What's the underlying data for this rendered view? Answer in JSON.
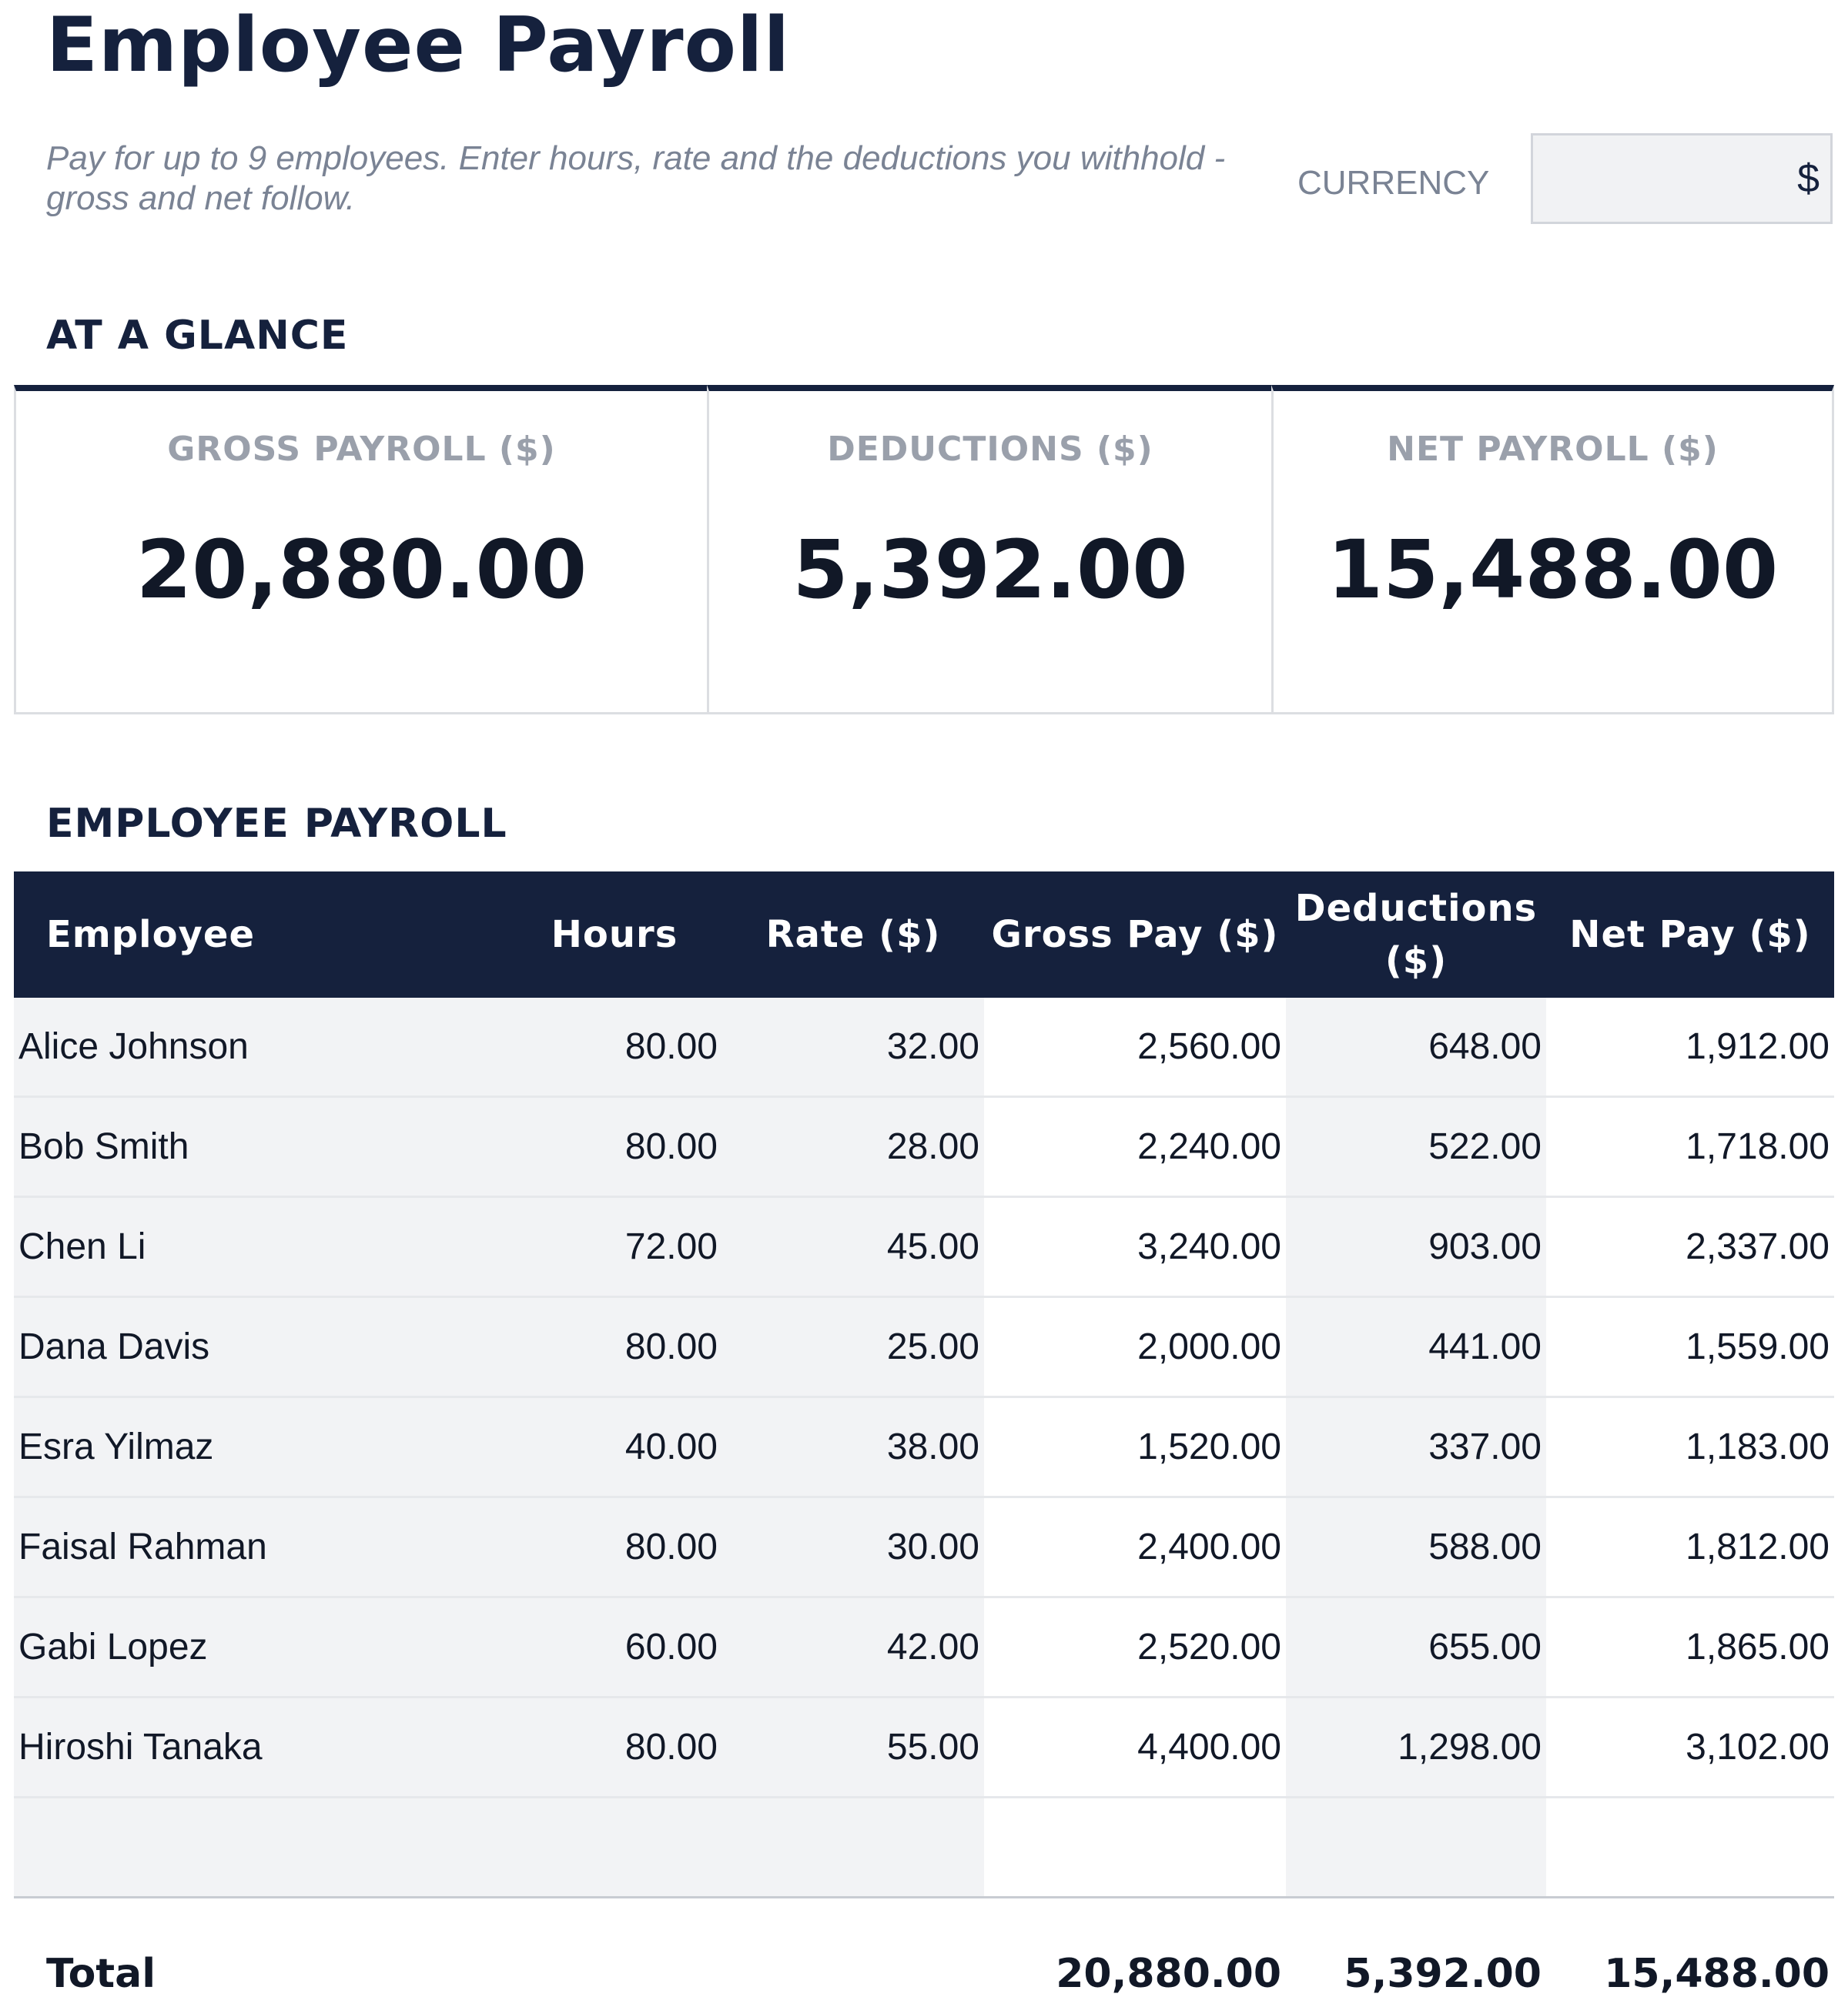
{
  "header": {
    "title": "Employee Payroll",
    "subtitle": "Pay for up to 9 employees. Enter hours, rate and the deductions you withhold - gross and net follow.",
    "currency_label": "CURRENCY",
    "currency_value": "$"
  },
  "glance": {
    "heading": "AT A GLANCE",
    "kpis": [
      {
        "label": "GROSS PAYROLL ($)",
        "value": "20,880.00"
      },
      {
        "label": "DEDUCTIONS ($)",
        "value": "5,392.00"
      },
      {
        "label": "NET PAYROLL ($)",
        "value": "15,488.00"
      }
    ]
  },
  "payroll": {
    "heading": "EMPLOYEE PAYROLL",
    "columns": [
      "Employee",
      "Hours",
      "Rate ($)",
      "Gross Pay ($)",
      "Deductions ($)",
      "Net Pay ($)"
    ],
    "rows": [
      [
        "Alice Johnson",
        "80.00",
        "32.00",
        "2,560.00",
        "648.00",
        "1,912.00"
      ],
      [
        "Bob Smith",
        "80.00",
        "28.00",
        "2,240.00",
        "522.00",
        "1,718.00"
      ],
      [
        "Chen Li",
        "72.00",
        "45.00",
        "3,240.00",
        "903.00",
        "2,337.00"
      ],
      [
        "Dana Davis",
        "80.00",
        "25.00",
        "2,000.00",
        "441.00",
        "1,559.00"
      ],
      [
        "Esra Yilmaz",
        "40.00",
        "38.00",
        "1,520.00",
        "337.00",
        "1,183.00"
      ],
      [
        "Faisal Rahman",
        "80.00",
        "30.00",
        "2,400.00",
        "588.00",
        "1,812.00"
      ],
      [
        "Gabi Lopez",
        "60.00",
        "42.00",
        "2,520.00",
        "655.00",
        "1,865.00"
      ],
      [
        "Hiroshi Tanaka",
        "80.00",
        "55.00",
        "4,400.00",
        "1,298.00",
        "3,102.00"
      ],
      [
        "",
        "",
        "",
        "",
        "",
        ""
      ]
    ],
    "totals": {
      "label": "Total",
      "gross": "20,880.00",
      "deductions": "5,392.00",
      "net": "15,488.00"
    }
  }
}
